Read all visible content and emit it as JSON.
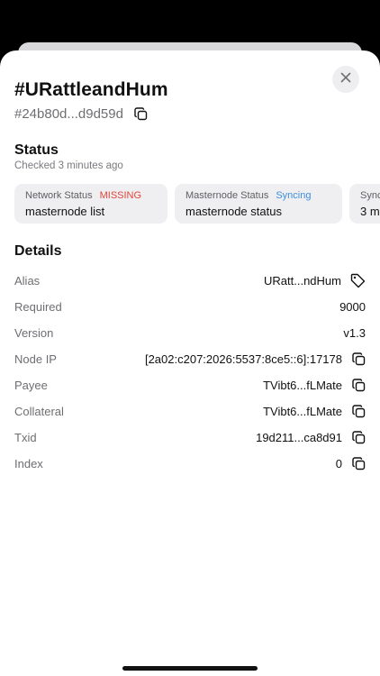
{
  "header": {
    "title": "#URattleandHum",
    "hash": "#24b80d...d9d59d"
  },
  "status": {
    "title": "Status",
    "checked": "Checked 3 minutes ago",
    "cards": [
      {
        "label": "Network Status",
        "badge": "MISSING",
        "badge_color": "#e0453a",
        "value": "masternode list"
      },
      {
        "label": "Masternode Status",
        "badge": "Syncing",
        "badge_color": "#3d8fe0",
        "value": "masternode status"
      },
      {
        "label": "Sync",
        "badge": "",
        "badge_color": "",
        "value": "3 m"
      }
    ]
  },
  "details": {
    "title": "Details",
    "rows": [
      {
        "label": "Alias",
        "value": "URatt...ndHum",
        "icon": "tag-icon"
      },
      {
        "label": "Required",
        "value": "9000",
        "icon": ""
      },
      {
        "label": "Version",
        "value": "v1.3",
        "icon": ""
      },
      {
        "label": "Node IP",
        "value": "[2a02:c207:2026:5537:8ce5::6]:17178",
        "icon": "copy-icon"
      },
      {
        "label": "Payee",
        "value": "TVibt6...fLMate",
        "icon": "copy-icon"
      },
      {
        "label": "Collateral",
        "value": "TVibt6...fLMate",
        "icon": "copy-icon"
      },
      {
        "label": "Txid",
        "value": "19d211...ca8d91",
        "icon": "copy-icon"
      },
      {
        "label": "Index",
        "value": "0",
        "icon": "copy-icon"
      }
    ]
  },
  "icons": {
    "close": "close-icon",
    "copy": "copy-icon",
    "tag": "tag-icon"
  }
}
